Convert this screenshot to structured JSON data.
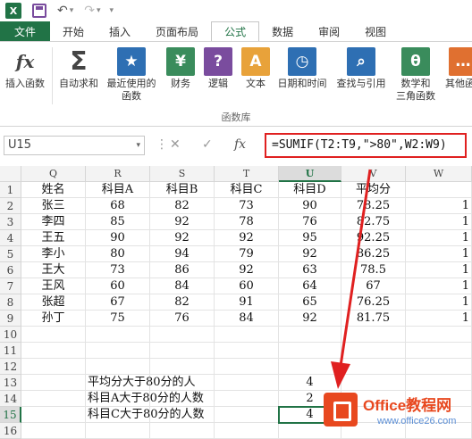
{
  "app": {
    "logo": "X",
    "colors": {
      "excel_green": "#217346",
      "highlight_red": "#e02020"
    }
  },
  "quick_access": {
    "save_icon": "save-icon",
    "undo_glyph": "↶",
    "redo_glyph": "↷",
    "customize_glyph": "▾"
  },
  "tabs": [
    {
      "label": "文件"
    },
    {
      "label": "开始"
    },
    {
      "label": "插入"
    },
    {
      "label": "页面布局"
    },
    {
      "label": "公式"
    },
    {
      "label": "数据"
    },
    {
      "label": "审阅"
    },
    {
      "label": "视图"
    }
  ],
  "ribbon": {
    "buttons": [
      {
        "label": "插入函数",
        "glyph": "fx",
        "color": "#444444"
      },
      {
        "label": "自动求和",
        "glyph": "Σ",
        "color": "#444444"
      },
      {
        "label": "最近使用的",
        "label2": "函数",
        "glyph": "★",
        "color": "#2e6fb3"
      },
      {
        "label": "财务",
        "glyph": "¥",
        "color": "#3a8c5c"
      },
      {
        "label": "逻辑",
        "glyph": "?",
        "color": "#7a4c9e"
      },
      {
        "label": "文本",
        "glyph": "A",
        "color": "#e8a23a"
      },
      {
        "label": "日期和时间",
        "glyph": "◷",
        "color": "#2e6fb3"
      },
      {
        "label": "查找与引用",
        "glyph": "⌕",
        "color": "#2e6fb3"
      },
      {
        "label": "数学和",
        "label2": "三角函数",
        "glyph": "θ",
        "color": "#3a8c5c"
      },
      {
        "label": "其他函",
        "glyph": "…",
        "color": "#e07030"
      }
    ],
    "group_label": "函数库"
  },
  "formula_bar": {
    "name_box": "U15",
    "cancel": "✕",
    "enter": "✓",
    "fx": "fx",
    "formula": "=SUMIF(T2:T9,\">80\",W2:W9)"
  },
  "sheet": {
    "columns": [
      "Q",
      "R",
      "S",
      "T",
      "U",
      "V",
      "W"
    ],
    "selected_column": "U",
    "rows": [
      {
        "num": "1",
        "cells": [
          "姓名",
          "科目A",
          "科目B",
          "科目C",
          "科目D",
          "平均分",
          ""
        ]
      },
      {
        "num": "2",
        "cells": [
          "张三",
          "68",
          "82",
          "73",
          "90",
          "78.25",
          "1"
        ]
      },
      {
        "num": "3",
        "cells": [
          "李四",
          "85",
          "92",
          "78",
          "76",
          "82.75",
          "1"
        ]
      },
      {
        "num": "4",
        "cells": [
          "王五",
          "90",
          "92",
          "92",
          "95",
          "92.25",
          "1"
        ]
      },
      {
        "num": "5",
        "cells": [
          "李小",
          "80",
          "94",
          "79",
          "92",
          "86.25",
          "1"
        ]
      },
      {
        "num": "6",
        "cells": [
          "王大",
          "73",
          "86",
          "92",
          "63",
          "78.5",
          "1"
        ]
      },
      {
        "num": "7",
        "cells": [
          "王风",
          "60",
          "84",
          "60",
          "64",
          "67",
          "1"
        ]
      },
      {
        "num": "8",
        "cells": [
          "张超",
          "67",
          "82",
          "91",
          "65",
          "76.25",
          "1"
        ]
      },
      {
        "num": "9",
        "cells": [
          "孙丁",
          "75",
          "76",
          "84",
          "92",
          "81.75",
          "1"
        ]
      },
      {
        "num": "10",
        "cells": [
          "",
          "",
          "",
          "",
          "",
          "",
          ""
        ]
      },
      {
        "num": "11",
        "cells": [
          "",
          "",
          "",
          "",
          "",
          "",
          ""
        ]
      },
      {
        "num": "12",
        "cells": [
          "",
          "",
          "",
          "",
          "",
          "",
          ""
        ]
      },
      {
        "num": "13",
        "cells": [
          "",
          "平均分大于80分的人",
          "",
          "",
          "4",
          "",
          ""
        ]
      },
      {
        "num": "14",
        "cells": [
          "",
          "科目A大于80分的人数",
          "",
          "",
          "2",
          "",
          ""
        ]
      },
      {
        "num": "15",
        "cells": [
          "",
          "科目C大于80分的人数",
          "",
          "",
          "4",
          "",
          ""
        ]
      },
      {
        "num": "16",
        "cells": [
          "",
          "",
          "",
          "",
          "",
          "",
          ""
        ]
      }
    ]
  },
  "watermark": {
    "text": "Office教程网",
    "url": "www.office26.com"
  }
}
